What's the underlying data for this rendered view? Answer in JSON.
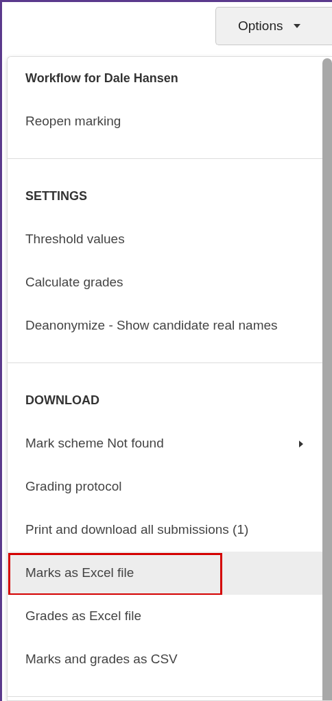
{
  "options_button": {
    "label": "Options",
    "expanded": true
  },
  "menu": {
    "sections": [
      {
        "heading": "Workflow for Dale Hansen",
        "items": [
          {
            "label": "Reopen marking",
            "submenu": false,
            "selected": false,
            "outlined": false
          }
        ]
      },
      {
        "heading": "SETTINGS",
        "items": [
          {
            "label": "Threshold values",
            "submenu": false,
            "selected": false,
            "outlined": false
          },
          {
            "label": "Calculate grades",
            "submenu": false,
            "selected": false,
            "outlined": false
          },
          {
            "label": "Deanonymize - Show candidate real names",
            "submenu": false,
            "selected": false,
            "outlined": false
          }
        ]
      },
      {
        "heading": "DOWNLOAD",
        "items": [
          {
            "label": "Mark scheme Not found",
            "submenu": true,
            "selected": false,
            "outlined": false
          },
          {
            "label": "Grading protocol",
            "submenu": false,
            "selected": false,
            "outlined": false
          },
          {
            "label": "Print and download all submissions (1)",
            "submenu": false,
            "selected": false,
            "outlined": false
          },
          {
            "label": "Marks as Excel file",
            "submenu": false,
            "selected": true,
            "outlined": true
          },
          {
            "label": "Grades as Excel file",
            "submenu": false,
            "selected": false,
            "outlined": false
          },
          {
            "label": "Marks and grades as CSV",
            "submenu": false,
            "selected": false,
            "outlined": false
          }
        ]
      }
    ]
  }
}
